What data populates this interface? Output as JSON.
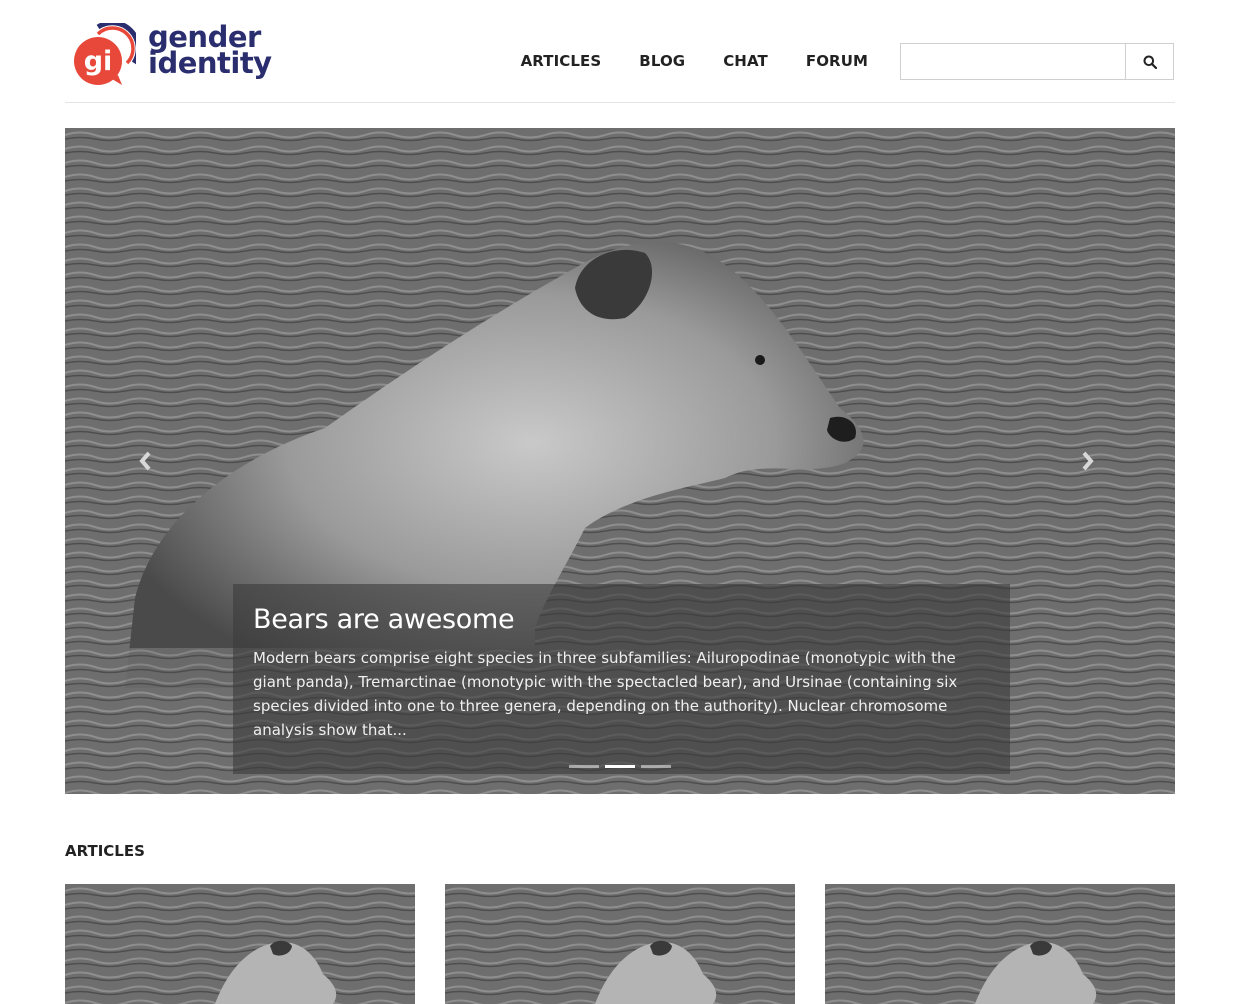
{
  "brand": {
    "logo_mark_text": "gi",
    "logo_line1": "gender",
    "logo_line2": "identity",
    "colors": {
      "mark": "#e8483a",
      "ring_blue": "#2b2e6e",
      "ring_red": "#e8483a",
      "wordmark": "#2b2e6e"
    }
  },
  "nav": {
    "items": [
      {
        "label": "ARTICLES"
      },
      {
        "label": "BLOG"
      },
      {
        "label": "CHAT"
      },
      {
        "label": "FORUM"
      }
    ]
  },
  "search": {
    "placeholder": "",
    "value": "",
    "icon": "search-icon"
  },
  "carousel": {
    "image": "bear-in-water",
    "title": "Bears are awesome",
    "text": "Modern bears comprise eight species in three subfamilies: Ailuropodinae (monotypic with the giant panda), Tremarctinae (monotypic with the spectacled bear), and Ursinae (containing six species divided into one to three genera, depending on the authority). Nuclear chromosome analysis show that...",
    "slides": 3,
    "active_slide": 2,
    "prev_icon": "chevron-left-icon",
    "next_icon": "chevron-right-icon"
  },
  "articles": {
    "heading": "ARTICLES",
    "cards": [
      {
        "image": "bear-in-water"
      },
      {
        "image": "bear-in-water"
      },
      {
        "image": "bear-in-water"
      }
    ]
  }
}
